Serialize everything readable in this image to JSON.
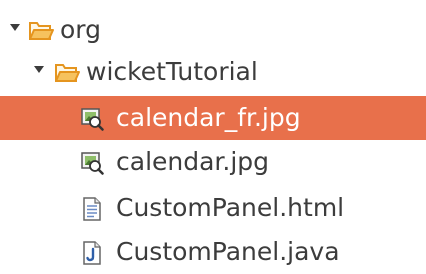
{
  "tree": {
    "items": [
      {
        "label": "org",
        "icon": "package-folder-icon",
        "expanded": true
      },
      {
        "label": "wicketTutorial",
        "icon": "package-folder-icon",
        "expanded": true
      },
      {
        "label": "calendar_fr.jpg",
        "icon": "image-file-icon",
        "selected": true
      },
      {
        "label": "calendar.jpg",
        "icon": "image-file-icon"
      },
      {
        "label": "CustomPanel.html",
        "icon": "html-file-icon"
      },
      {
        "label": "CustomPanel.java",
        "icon": "java-file-icon"
      }
    ]
  },
  "colors": {
    "selection": "#e8704b",
    "folder": "#f2a93b",
    "text": "#3c3c3c"
  }
}
